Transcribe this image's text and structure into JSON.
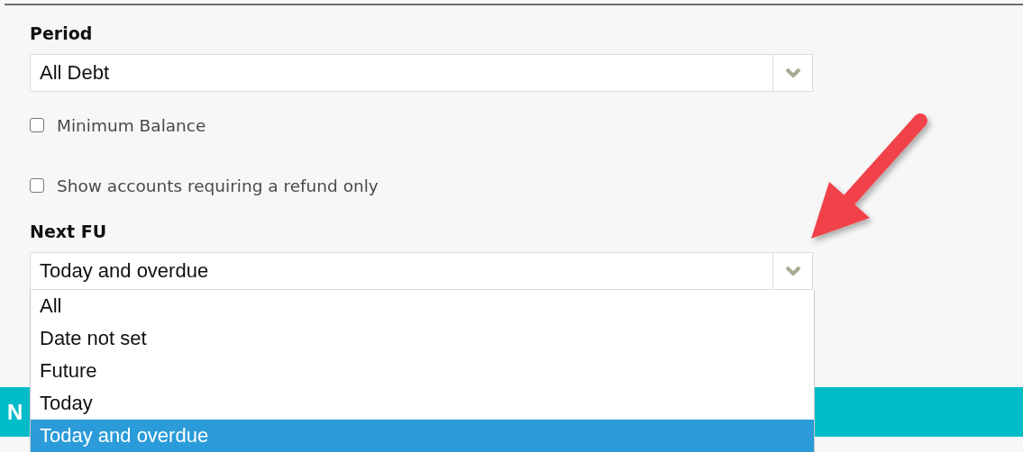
{
  "filters": [
    {
      "kind": "select",
      "label": "Period",
      "value": "All Debt"
    },
    {
      "kind": "checkbox",
      "label": "Minimum Balance",
      "checked": false
    },
    {
      "kind": "checkbox",
      "label": "Show accounts requiring a refund only",
      "checked": false
    },
    {
      "kind": "select",
      "label": "Next FU",
      "value": "Today and overdue",
      "options": [
        {
          "label": "All",
          "selected": false
        },
        {
          "label": "Date not set",
          "selected": false
        },
        {
          "label": "Future",
          "selected": false
        },
        {
          "label": "Today",
          "selected": false
        },
        {
          "label": "Today and overdue",
          "selected": true
        }
      ]
    }
  ],
  "banner": {
    "text": "N"
  }
}
